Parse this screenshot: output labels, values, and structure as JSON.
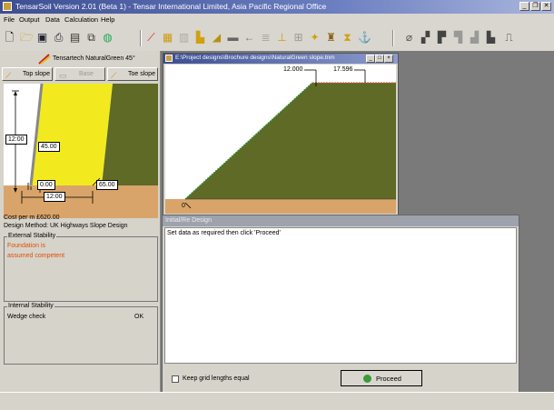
{
  "window": {
    "title": "TensarSoil Version 2.01 (Beta 1)  -  Tensar International Limited, Asia Pacific Regional Office",
    "min": "_",
    "restore": "❐",
    "close": "✕"
  },
  "menu": [
    "File",
    "Output",
    "Data",
    "Calculation",
    "Help"
  ],
  "left_panel": {
    "product_label": "Tensartech NaturalGreen 45°",
    "buttons": {
      "top_slope": "Top slope",
      "base": "Base",
      "toe_slope": "Toe slope"
    },
    "diagram": {
      "height_label": "12:00",
      "angle_label": "45.00",
      "toe_label": "0.00",
      "width_label": "12:00",
      "side_label": "65.00"
    },
    "cost_line": "Cost per  m  £620.00",
    "design_method": "Design Method:  UK Highways Slope Design",
    "external_stability": {
      "title": "External Stability",
      "note_line1": "Foundation is",
      "note_line2": "assumed competent"
    },
    "internal_stability": {
      "title": "Internal Stability",
      "check_name": "Wedge check",
      "check_result": "OK"
    }
  },
  "drawing_window": {
    "title": "E:\\Project designs\\Brochure designs\\NaturalGreen slope.tnm",
    "dim_left": "12.000",
    "dim_right": "17.596",
    "origin_label": "0"
  },
  "message_window": {
    "title": "Initial/Re Design",
    "message": "Set data as required then click 'Proceed'",
    "checkbox_label": "Keep grid lengths equal",
    "proceed_label": "Proceed"
  },
  "colors": {
    "slope_fill": "#5e6a26",
    "facing_fill": "#f2ea1f",
    "soil_fill": "#d9a46a",
    "window_title": "#3d4e92"
  }
}
